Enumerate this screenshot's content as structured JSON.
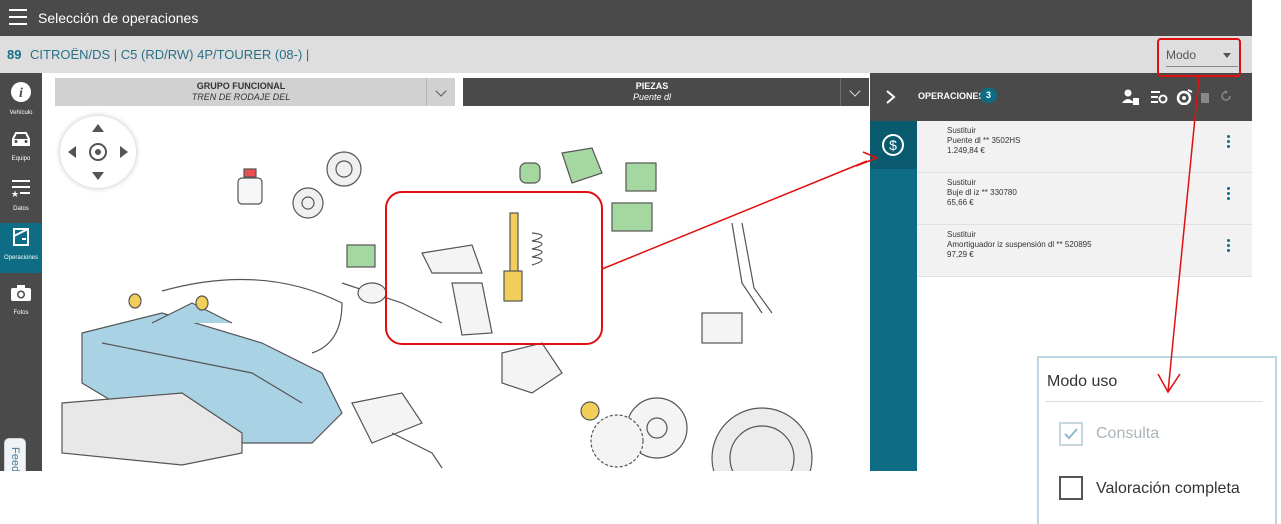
{
  "app": {
    "title": "Selección de operaciones"
  },
  "vehicle": {
    "id": "89",
    "description": "CITROËN/DS | C5 (RD/RW) 4P/TOURER (08-) |"
  },
  "mode_select": {
    "label": "Modo"
  },
  "sidebar": {
    "items": [
      {
        "label": "Vehículo",
        "icon": "info-icon"
      },
      {
        "label": "Equipo",
        "icon": "car-icon"
      },
      {
        "label": "Datos",
        "icon": "list-star-icon"
      },
      {
        "label": "Operaciones",
        "icon": "door-icon",
        "active": true
      },
      {
        "label": "Fotos",
        "icon": "camera-icon"
      }
    ]
  },
  "feedback": {
    "label": "Feedback"
  },
  "filters": {
    "grupo_funcional": {
      "title": "GRUPO FUNCIONAL",
      "value": "TREN DE RODAJE DEL"
    },
    "piezas": {
      "title": "PIEZAS",
      "value": "Puente dl"
    }
  },
  "operations": {
    "title": "OPERACIONES",
    "count": "3",
    "items": [
      {
        "action": "Sustituir",
        "part": "Puente dl ** 3502HS",
        "price": "1.249,84 €"
      },
      {
        "action": "Sustituir",
        "part": "Buje dl iz ** 330780",
        "price": "65,66 €"
      },
      {
        "action": "Sustituir",
        "part": "Amortiguador iz suspensión dl ** 520895",
        "price": "97,29 €"
      }
    ]
  },
  "modo_uso": {
    "title": "Modo uso",
    "options": [
      {
        "label": "Consulta",
        "checked": true
      },
      {
        "label": "Valoración completa",
        "checked": false
      }
    ]
  },
  "colors": {
    "accent": "#0e6d85",
    "dark": "#4a4a4a",
    "annotation": "#e01010"
  }
}
